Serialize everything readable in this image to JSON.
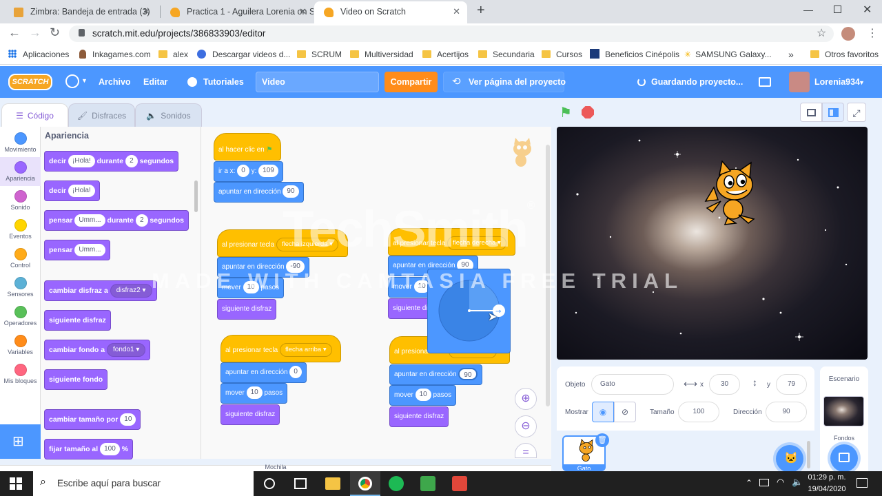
{
  "browser": {
    "tabs": [
      {
        "title": "Zimbra: Bandeja de entrada (3)",
        "icon": "zimbra-icon"
      },
      {
        "title": "Practica 1 - Aguilera Lorenia on S",
        "icon": "scratch-icon"
      },
      {
        "title": "Video on Scratch",
        "icon": "scratch-icon"
      }
    ],
    "url": "scratch.mit.edu/projects/386833903/editor",
    "bookmarks": [
      "Aplicaciones",
      "Inkagames.com",
      "alex",
      "Descargar videos d...",
      "SCRUM",
      "Multiversidad",
      "Acertijos",
      "Secundaria",
      "Cursos",
      "Beneficios Cinépolis",
      "SAMSUNG Galaxy...",
      "Otros favoritos"
    ],
    "more_bookmarks": "»"
  },
  "menu": {
    "logo": "SCRATCH",
    "archivo": "Archivo",
    "editar": "Editar",
    "tutoriales": "Tutoriales",
    "project_title": "Video",
    "compartir": "Compartir",
    "ver_pagina": "Ver página del proyecto",
    "saving": "Guardando proyecto...",
    "user": "Lorenia934"
  },
  "tabs": {
    "codigo": "Código",
    "disfraces": "Disfraces",
    "sonidos": "Sonidos"
  },
  "categories": [
    {
      "label": "Movimiento",
      "color": "#4c97ff"
    },
    {
      "label": "Apariencia",
      "color": "#9966ff"
    },
    {
      "label": "Sonido",
      "color": "#cf63cf"
    },
    {
      "label": "Eventos",
      "color": "#ffd500"
    },
    {
      "label": "Control",
      "color": "#ffab19"
    },
    {
      "label": "Sensores",
      "color": "#5cb1d6"
    },
    {
      "label": "Operadores",
      "color": "#59c059"
    },
    {
      "label": "Variables",
      "color": "#ff8c1a"
    },
    {
      "label": "Mis bloques",
      "color": "#ff6680"
    }
  ],
  "palette": {
    "heading": "Apariencia",
    "b1": {
      "a": "decir",
      "v1": "¡Hola!",
      "b": "durante",
      "v2": "2",
      "c": "segundos"
    },
    "b2": {
      "a": "decir",
      "v1": "¡Hola!"
    },
    "b3": {
      "a": "pensar",
      "v1": "Umm...",
      "b": "durante",
      "v2": "2",
      "c": "segundos"
    },
    "b4": {
      "a": "pensar",
      "v1": "Umm..."
    },
    "b5": {
      "a": "cambiar disfraz a",
      "v1": "disfraz2"
    },
    "b6": {
      "a": "siguiente disfraz"
    },
    "b7": {
      "a": "cambiar fondo a",
      "v1": "fondo1"
    },
    "b8": {
      "a": "siguiente fondo"
    },
    "b9": {
      "a": "cambiar tamaño por",
      "v1": "10"
    },
    "b10": {
      "a": "fijar tamaño al",
      "v1": "100",
      "b": "%"
    }
  },
  "scripts": {
    "s1": {
      "hat": "al hacer clic en",
      "goto_a": "ir a x:",
      "x": "0",
      "goto_b": "y:",
      "y": "109",
      "point": "apuntar en dirección",
      "dir": "90"
    },
    "s2": {
      "hat": "al presionar tecla",
      "key": "flecha izquierda",
      "point": "apuntar en dirección",
      "dir": "-90",
      "move": "mover",
      "steps": "10",
      "pasos": "pasos",
      "next": "siguiente disfraz"
    },
    "s3": {
      "hat": "al presionar tecla",
      "key": "flecha derecha",
      "point": "apuntar en dirección",
      "dir": "90",
      "move": "mover",
      "steps": "10",
      "next": "siguiente di"
    },
    "s4": {
      "hat": "al presionar tecla",
      "key": "flecha arriba",
      "point": "apuntar en dirección",
      "dir": "0",
      "move": "mover",
      "steps": "10",
      "pasos": "pasos",
      "next": "siguiente disfraz"
    },
    "s5": {
      "hat": "al presionar tecla",
      "point": "apuntar en dirección",
      "dir": "90",
      "move": "mover",
      "steps": "10",
      "pasos": "pasos",
      "next": "siguiente disfraz"
    }
  },
  "dial": {
    "value": 90
  },
  "sprite_info": {
    "objeto": "Objeto",
    "name": "Gato",
    "x_label": "x",
    "x": "30",
    "y_label": "y",
    "y": "79",
    "mostrar": "Mostrar",
    "tamano_label": "Tamaño",
    "tamano": "100",
    "direccion_label": "Dirección",
    "direccion": "90",
    "thumb_label": "Gato"
  },
  "stage_pane": {
    "title": "Escenario",
    "fondos": "Fondos"
  },
  "scroll_label": "Mochila",
  "watermark": {
    "line1": "TechSmith",
    "reg": "®",
    "line2": "MADE WITH CAMTASIA FREE TRIAL"
  },
  "taskbar": {
    "search": "Escribe aquí para buscar",
    "time": "01:29 p. m.",
    "date": "19/04/2020"
  }
}
